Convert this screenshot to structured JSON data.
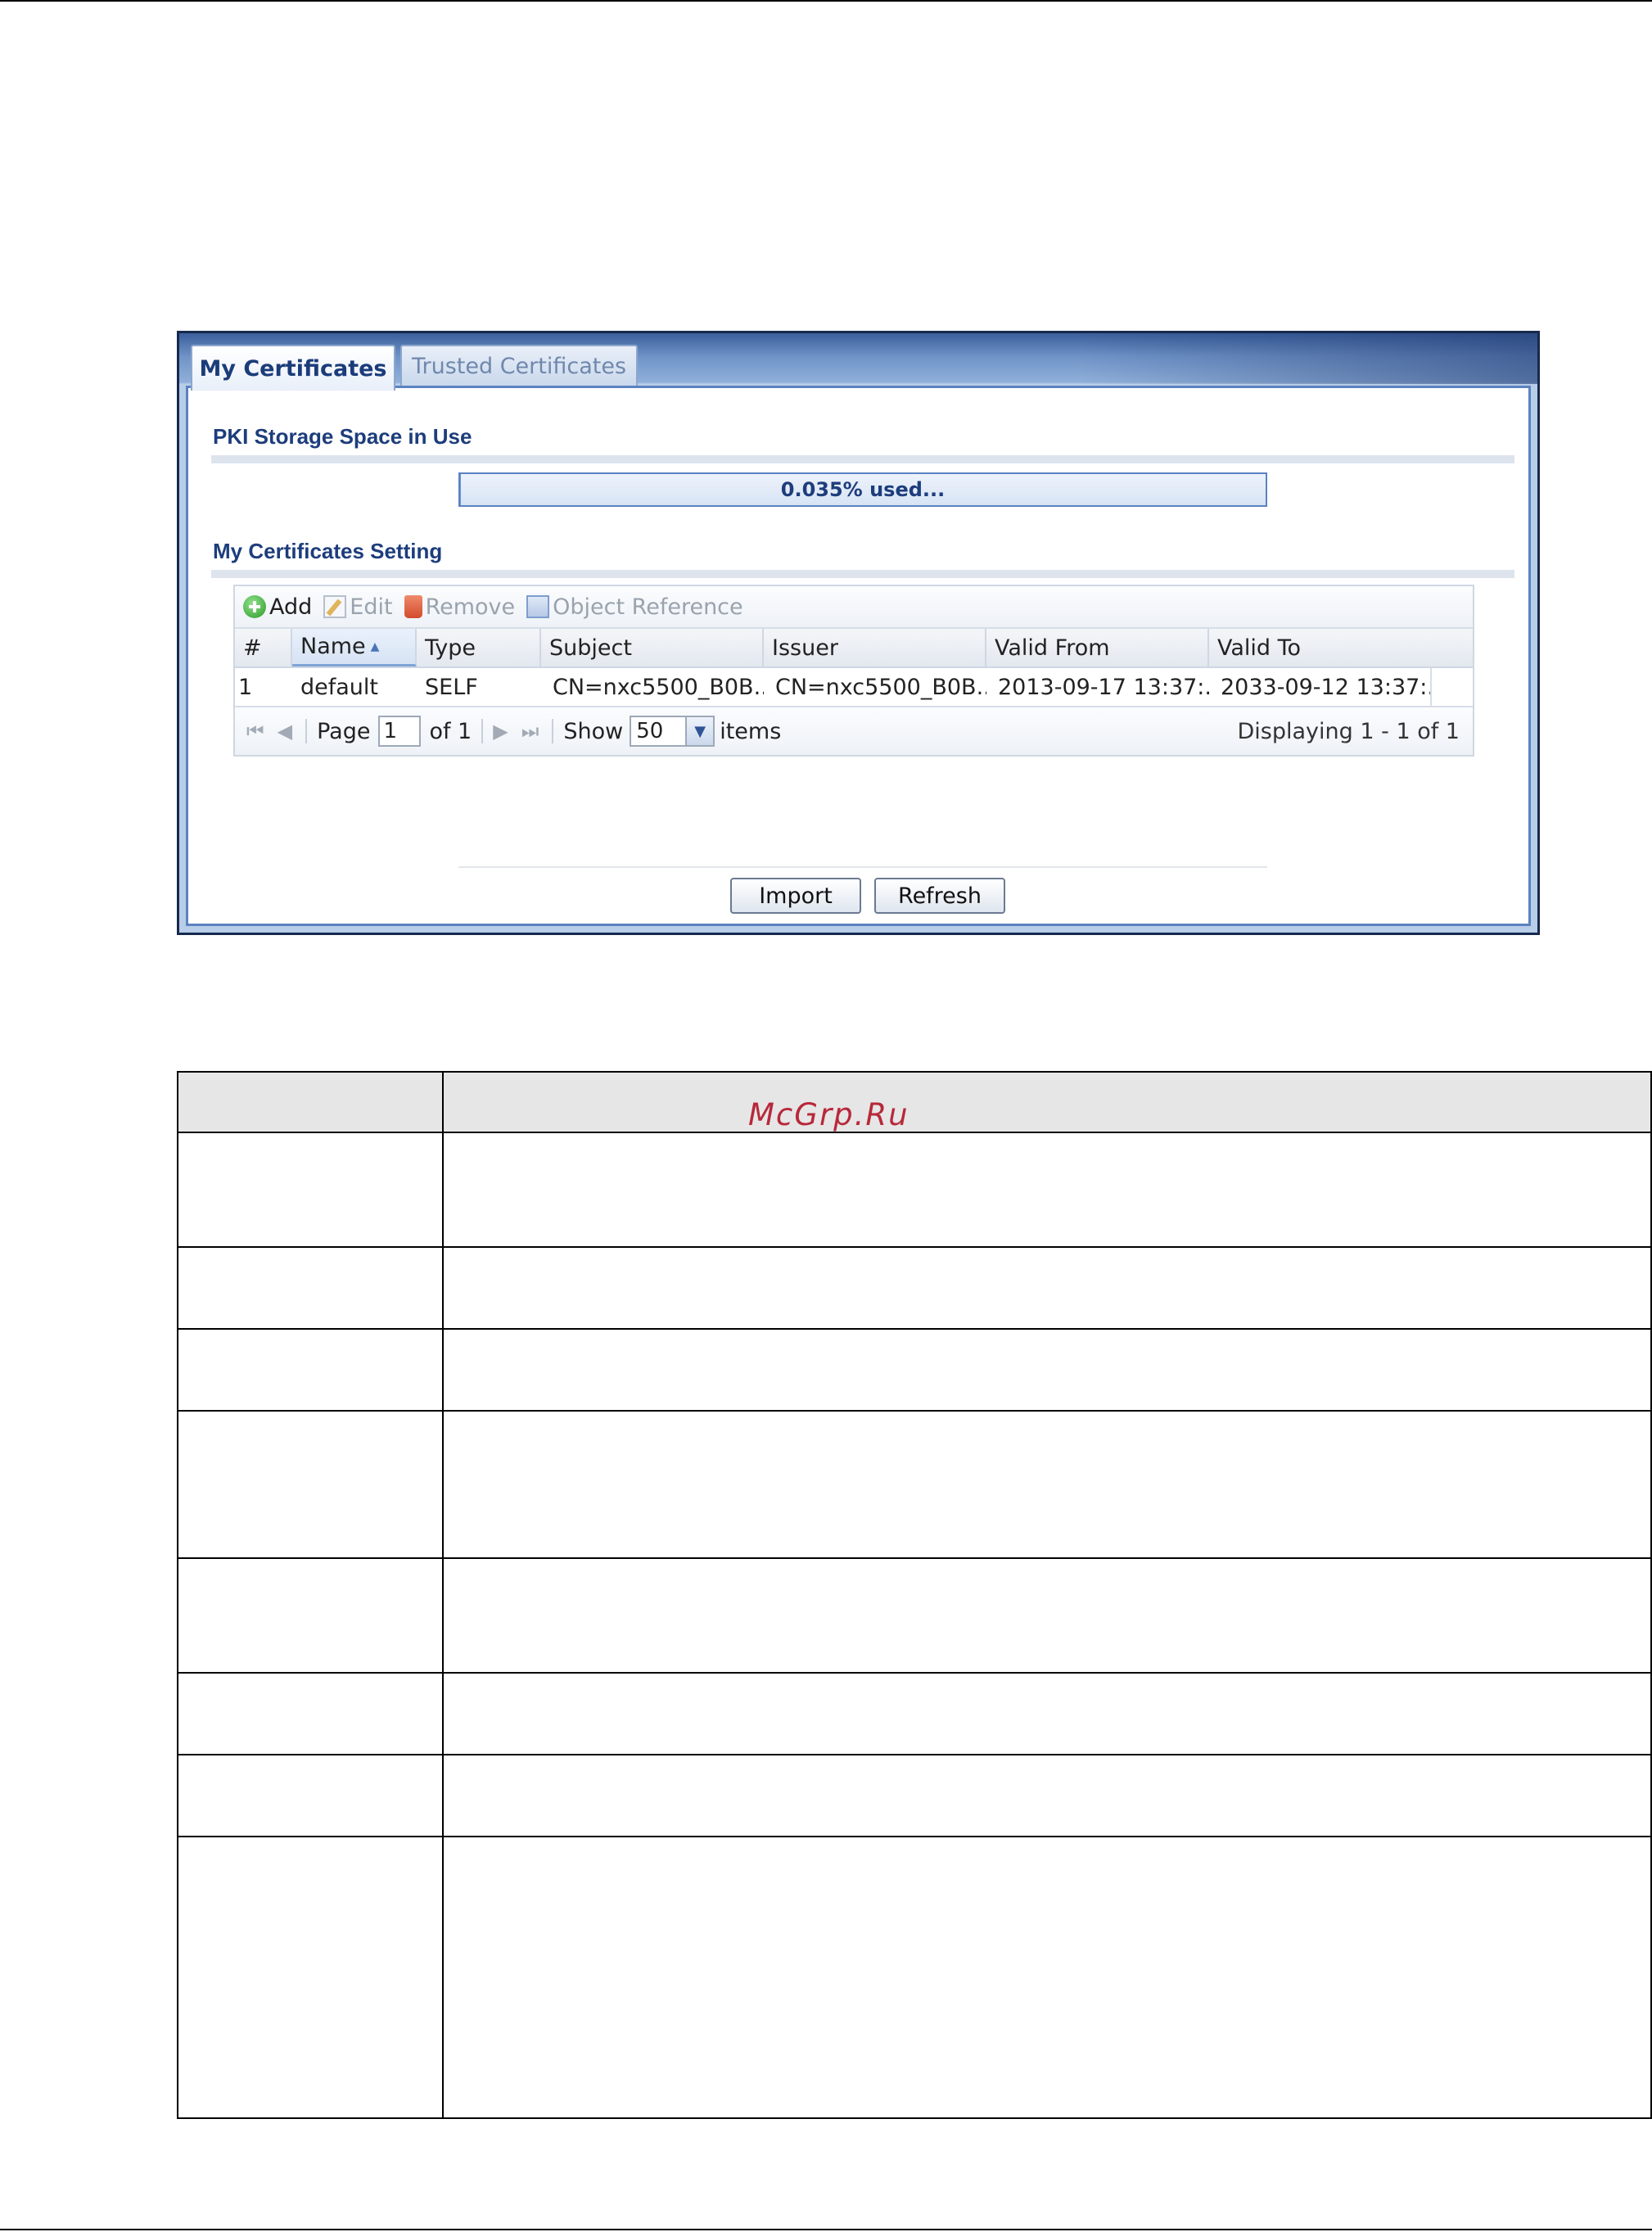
{
  "tabs": [
    {
      "label": "My Certificates",
      "active": true
    },
    {
      "label": "Trusted Certificates",
      "active": false
    }
  ],
  "storage": {
    "title": "PKI Storage Space in Use",
    "used_percent": 0.035,
    "label": "0.035% used..."
  },
  "certificates": {
    "title": "My Certificates Setting",
    "toolbar": {
      "add": "Add",
      "edit": "Edit",
      "remove": "Remove",
      "object_reference": "Object Reference"
    },
    "columns": [
      "#",
      "Name",
      "Type",
      "Subject",
      "Issuer",
      "Valid From",
      "Valid To"
    ],
    "sorted_column": "Name",
    "rows": [
      {
        "num": "1",
        "name": "default",
        "type": "SELF",
        "subject": "CN=nxc5500_B0B...",
        "issuer": "CN=nxc5500_B0B...",
        "valid_from": "2013-09-17 13:37:...",
        "valid_to": "2033-09-12 13:37:..."
      }
    ],
    "pager": {
      "page_label": "Page",
      "page_value": "1",
      "of_label": "of 1",
      "show_label": "Show",
      "show_value": "50",
      "items_label": "items",
      "display_text": "Displaying 1 - 1 of 1"
    }
  },
  "buttons": {
    "import": "Import",
    "refresh": "Refresh"
  },
  "watermark": "McGrp.Ru",
  "colors": {
    "accent_blue": "#1d3d7c",
    "frame_border": "#5b82c1",
    "watermark_red": "#b8283a"
  }
}
